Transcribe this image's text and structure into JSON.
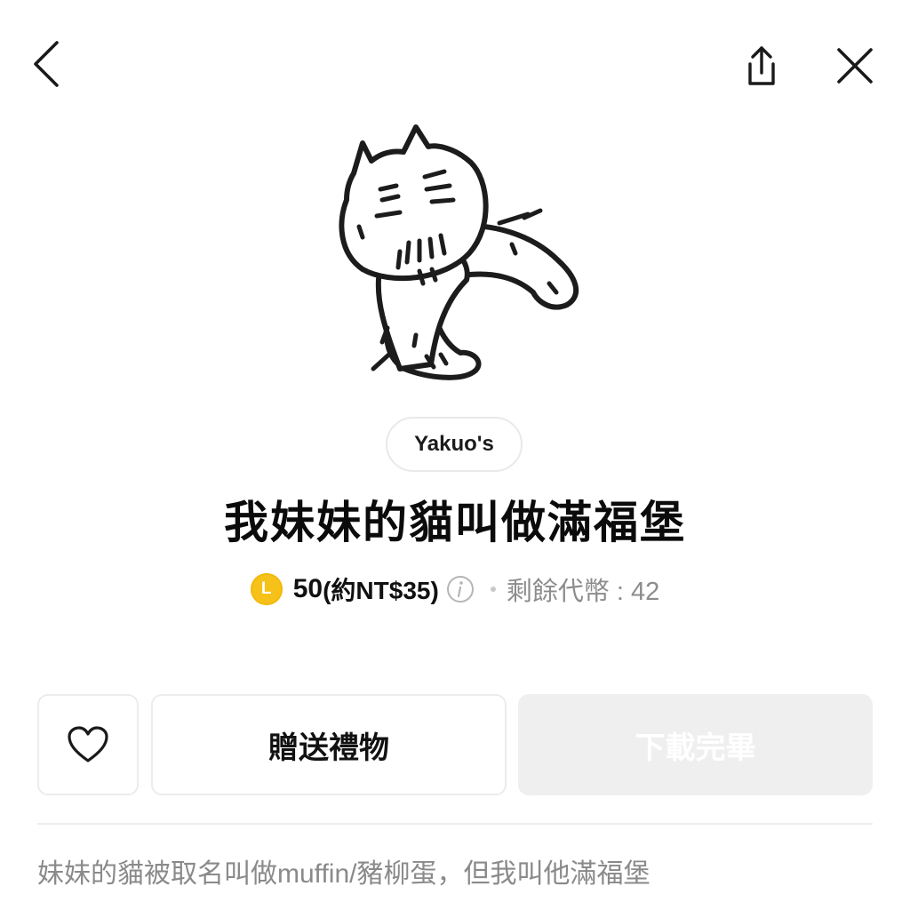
{
  "header": {
    "back_icon": "chevron-left-icon",
    "share_icon": "share-icon",
    "close_icon": "close-icon"
  },
  "sticker": {
    "image_icon": "cat-sticker-illustration"
  },
  "author": {
    "name": "Yakuo's"
  },
  "product": {
    "title": "我妹妹的貓叫做滿福堡",
    "coin_symbol": "L",
    "coin_color": "#f6c21a",
    "price": "50",
    "price_approx": "(約NT$35)",
    "info_icon": "info-icon",
    "remaining_label": "剩餘代幣 : 42"
  },
  "actions": {
    "favorite_icon": "heart-icon",
    "gift_label": "贈送禮物",
    "download_label": "下載完畢",
    "download_disabled_color": "#efefef"
  },
  "description": {
    "text": "妹妹的貓被取名叫做muffin/豬柳蛋，但我叫他滿福堡"
  }
}
